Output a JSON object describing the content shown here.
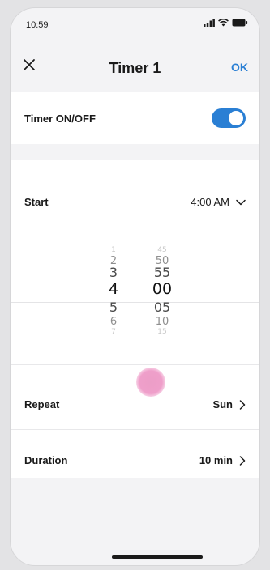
{
  "status_bar": {
    "time": "10:59",
    "icons": [
      "signal-icon",
      "wifi-icon",
      "battery-icon"
    ]
  },
  "header": {
    "close_icon": "close-icon",
    "title": "Timer 1",
    "ok_label": "OK"
  },
  "timer_toggle": {
    "label": "Timer ON/OFF",
    "state": "on"
  },
  "start": {
    "label": "Start",
    "value": "4:00 AM",
    "chevron": "chevron-down-icon"
  },
  "picker": {
    "hours": [
      "1",
      "2",
      "3",
      "4",
      "5",
      "6",
      "7"
    ],
    "minutes": [
      "45",
      "50",
      "55",
      "00",
      "05",
      "10",
      "15"
    ],
    "selected_hour": "4",
    "selected_minute": "00"
  },
  "repeat": {
    "label": "Repeat",
    "value": "Sun",
    "chevron": "chevron-right-icon"
  },
  "duration": {
    "label": "Duration",
    "value": "10 min",
    "chevron": "chevron-right-icon"
  },
  "colors": {
    "accent": "#2a7fd4",
    "toggle_on": "#2a7fd4",
    "touch_indicator": "#ef9fca",
    "background": "#f3f3f5",
    "card": "#ffffff"
  }
}
